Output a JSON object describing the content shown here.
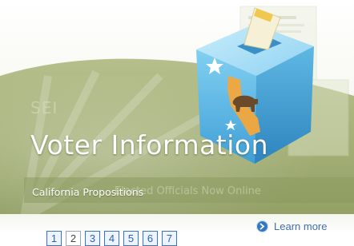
{
  "banner": {
    "faded_text": "SEI",
    "title": "Voter Information",
    "subtitle": "California Propositions",
    "ghost_subtitle": "Elected Officials Now Online"
  },
  "learn_more": {
    "label": "Learn more",
    "icon": "arrow-circle-icon"
  },
  "pager": {
    "pages": [
      "1",
      "2",
      "3",
      "4",
      "5",
      "6",
      "7"
    ],
    "active_page": "2"
  },
  "colors": {
    "banner_green": "#a6b27a",
    "banner_dark": "#8e9b62",
    "ballot_box_blue": "#5db8e4",
    "link_blue": "#3f6fb0",
    "pager_border": "#3b73c4"
  }
}
